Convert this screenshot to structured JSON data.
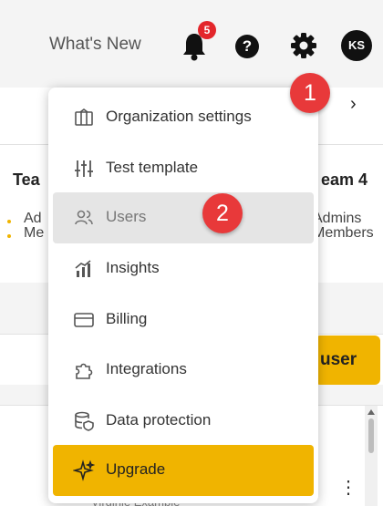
{
  "header": {
    "whats_new": "What's New",
    "notification_count": "5",
    "help_symbol": "?",
    "avatar_initials": "KS"
  },
  "background": {
    "chevron": "›",
    "team_left": "Tea",
    "team_right": "eam 4",
    "admins_left": "Ad",
    "admins_right": "Admins",
    "members_left": "Me",
    "members_right": "Members",
    "add_user_label": "user",
    "row_peek": "Virginie Example",
    "kebab": "⋮"
  },
  "menu": {
    "items": [
      {
        "label": "Organization settings",
        "icon": "building-icon"
      },
      {
        "label": "Test template",
        "icon": "sliders-icon"
      },
      {
        "label": "Users",
        "icon": "users-icon"
      },
      {
        "label": "Insights",
        "icon": "insights-icon"
      },
      {
        "label": "Billing",
        "icon": "credit-card-icon"
      },
      {
        "label": "Integrations",
        "icon": "puzzle-icon"
      },
      {
        "label": "Data protection",
        "icon": "database-shield-icon"
      },
      {
        "label": "Upgrade",
        "icon": "sparkle-icon"
      }
    ]
  },
  "callouts": {
    "step1": "1",
    "step2": "2"
  },
  "colors": {
    "accent": "#f0b400",
    "callout": "#e8393a",
    "badge": "#e3262b"
  }
}
